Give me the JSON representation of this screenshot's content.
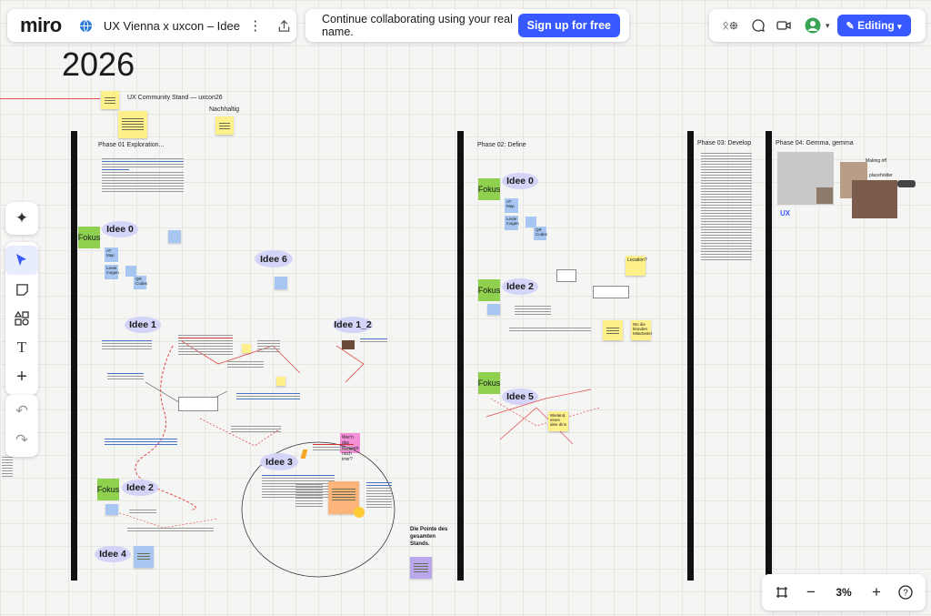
{
  "app": {
    "logo": "miro",
    "board_title": "UX Vienna x uxcon – Ideen & A..."
  },
  "banner": {
    "text": "Continue collaborating using your real name.",
    "signup_label": "Sign up for free"
  },
  "right_bar": {
    "editing_label": "Editing"
  },
  "icons": [
    "board-icon",
    "more-icon",
    "share-icon",
    "reactions-icon",
    "chat-icon",
    "video-icon",
    "avatar-icon",
    "pencil-icon",
    "chevron-down-icon",
    "sparkle-icon",
    "select-icon",
    "sticky-note-icon",
    "shapes-icon",
    "text-icon",
    "plus-icon",
    "undo-icon",
    "redo-icon",
    "fit-icon",
    "zoom-out-icon",
    "zoom-in-icon",
    "help-icon"
  ],
  "zoom": {
    "level": "3%"
  },
  "canvas": {
    "year": "2026",
    "stand_label": "UX Community Stand — uxcon26",
    "nachhaltig": "Nachhaltig",
    "phases": [
      "Phase 01 Exploration...",
      "Phase 02: Define",
      "Phase 03: Develop",
      "Phase 04: Gemma, gemma"
    ],
    "ideas": {
      "i0a": "Idee 0",
      "i6": "Idee 6",
      "i1": "Idee 1",
      "i1_2": "Idee 1_2",
      "i3": "Idee 3",
      "i2a": "Idee 2",
      "i4": "Idee 4",
      "i0b": "Idee 0",
      "i2b": "Idee 2",
      "i5": "Idee 5"
    },
    "fokus": "Fokus",
    "mini_notes": {
      "at_map": "AT Map",
      "lesen": "Leute mogen",
      "qr": "QR Codes",
      "at_map2": "AT Map",
      "lesen2": "Leute mogen",
      "qr2": "QR Codes"
    },
    "pink_note": "Wer'n das Konzept noch irrer?",
    "pointe": "Die Pointe des gesamten Stands.",
    "location": "Location?",
    "wo_blonde": "Wo die blonden Mitarbeiter",
    "wieland": "Wieland, eines idee dins",
    "making_off": "Making off",
    "placeholder": "placeholder"
  },
  "colors": {
    "accent": "#3859ff",
    "sticky_yellow": "#fef08a",
    "sticky_blue": "#a7c7f2",
    "sticky_green": "#8fd14f",
    "idea_bubble": "#d3d4f7"
  }
}
